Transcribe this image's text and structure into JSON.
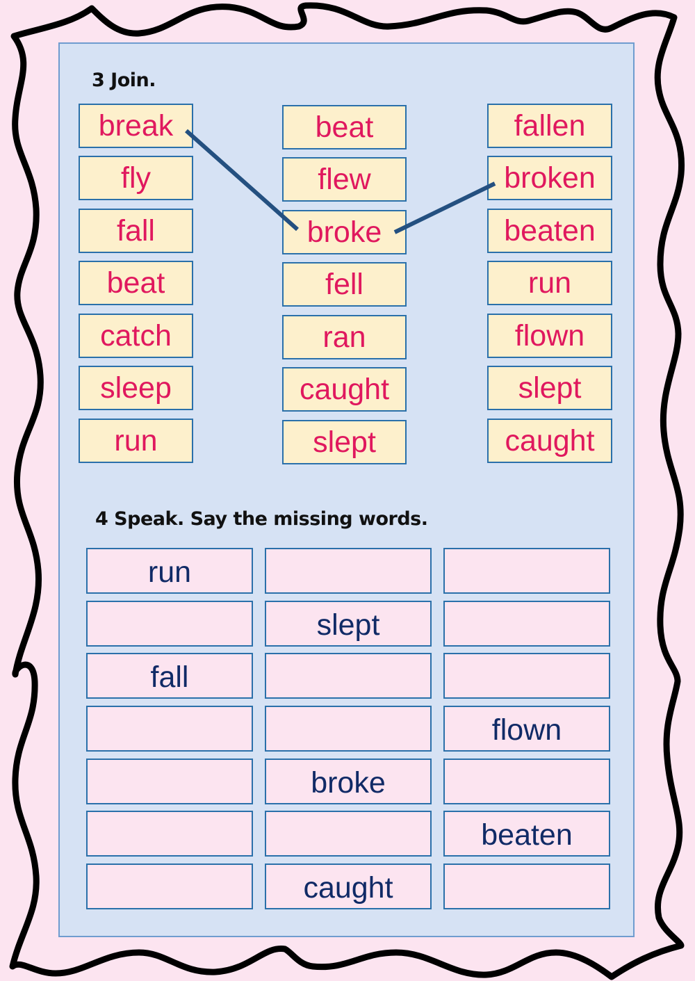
{
  "colors": {
    "page_background": "#fce4f0",
    "panel_background": "#d6e2f4",
    "join_box_fill": "#fdf0cc",
    "join_text": "#e0185e",
    "speak_text": "#102a66",
    "box_border": "#2a70aa",
    "connector_line": "#245080"
  },
  "exercise3": {
    "heading": "3 Join.",
    "columns": [
      [
        "break",
        "fly",
        "fall",
        "beat",
        "catch",
        "sleep",
        "run"
      ],
      [
        "beat",
        "flew",
        "broke",
        "fell",
        "ran",
        "caught",
        "slept"
      ],
      [
        "fallen",
        "broken",
        "beaten",
        "run",
        "flown",
        "slept",
        "caught"
      ]
    ],
    "connections": [
      {
        "from": {
          "column": 0,
          "row": 0,
          "word": "break"
        },
        "to": {
          "column": 1,
          "row": 2,
          "word": "broke"
        }
      },
      {
        "from": {
          "column": 1,
          "row": 2,
          "word": "broke"
        },
        "to": {
          "column": 2,
          "row": 1,
          "word": "broken"
        }
      }
    ]
  },
  "exercise4": {
    "heading": "4 Speak. Say the missing words.",
    "rows": [
      [
        "run",
        "",
        ""
      ],
      [
        "",
        "slept",
        ""
      ],
      [
        "fall",
        "",
        ""
      ],
      [
        "",
        "",
        "flown"
      ],
      [
        "",
        "broke",
        ""
      ],
      [
        "",
        "",
        "beaten"
      ],
      [
        "",
        "caught",
        ""
      ]
    ]
  }
}
